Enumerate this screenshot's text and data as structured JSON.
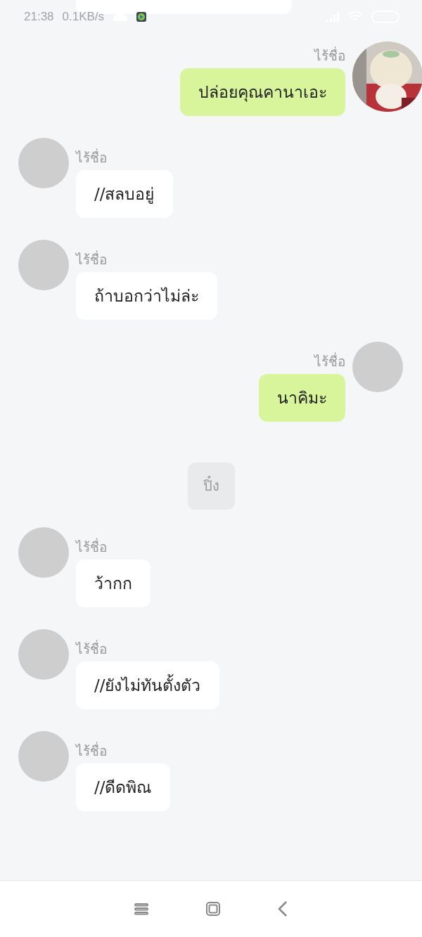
{
  "status_bar": {
    "time": "21:38",
    "speed": "0.1KB/s"
  },
  "messages": [
    {
      "kind": "cut-bubble"
    },
    {
      "kind": "message",
      "outgoing": true,
      "name": "ไร้ชื่อ",
      "text": "ปล่อยคุณคานาเอะ",
      "photo_avatar": true
    },
    {
      "kind": "message",
      "outgoing": false,
      "name": "ไร้ชื่อ",
      "text": "//สลบอยู่",
      "photo_avatar": false
    },
    {
      "kind": "message",
      "outgoing": false,
      "name": "ไร้ชื่อ",
      "text": "ถ้าบอกว่าไม่ล่ะ",
      "photo_avatar": false
    },
    {
      "kind": "message",
      "outgoing": true,
      "name": "ไร้ชื่อ",
      "text": "นาคิมะ",
      "photo_avatar": false
    },
    {
      "kind": "system",
      "text": "ปิ๋ง"
    },
    {
      "kind": "message",
      "outgoing": false,
      "name": "ไร้ชื่อ",
      "text": "ว้ากก",
      "photo_avatar": false
    },
    {
      "kind": "message",
      "outgoing": false,
      "name": "ไร้ชื่อ",
      "text": "//ยังไม่ทันตั้งตัว",
      "photo_avatar": false
    },
    {
      "kind": "message",
      "outgoing": false,
      "name": "ไร้ชื่อ",
      "text": "//ดีดพิณ",
      "photo_avatar": false
    }
  ]
}
